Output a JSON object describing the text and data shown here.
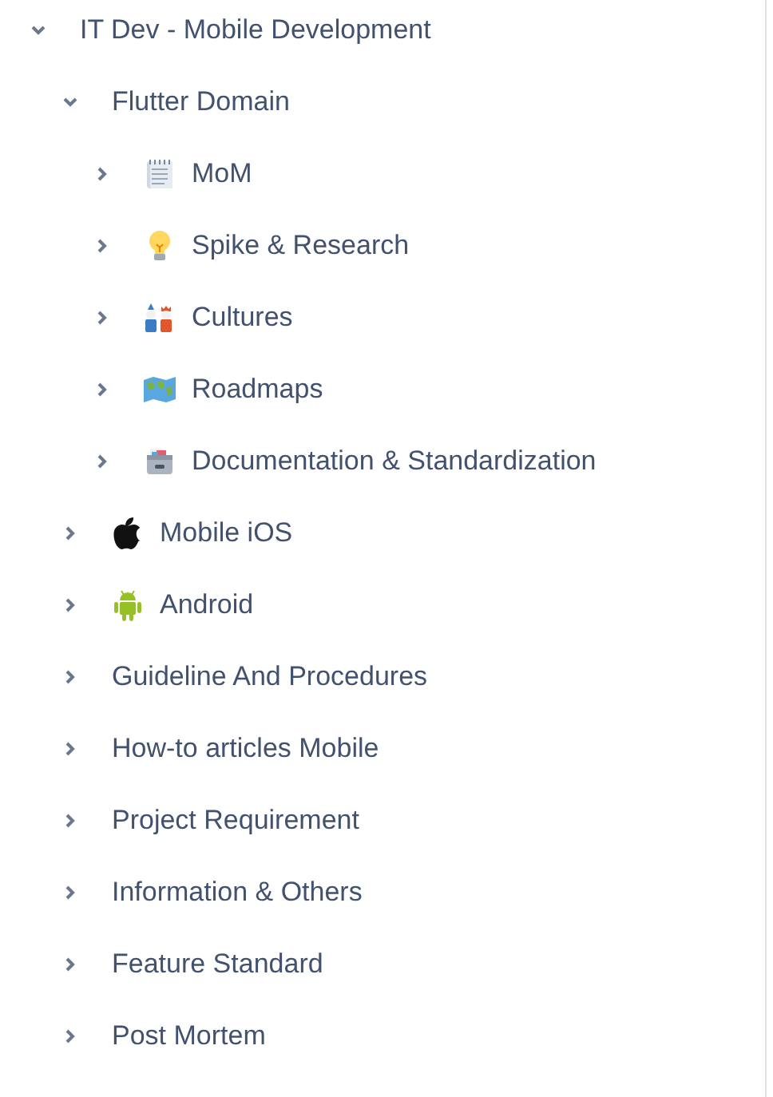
{
  "tree": [
    {
      "label": "IT Dev - Mobile Development",
      "expanded": true,
      "children": [
        {
          "label": "Flutter Domain",
          "expanded": true,
          "children": [
            {
              "label": "MoM",
              "kind": "notes",
              "expanded": false
            },
            {
              "label": "Spike & Research",
              "kind": "idea",
              "expanded": false
            },
            {
              "label": "Cultures",
              "kind": "dolls",
              "expanded": false
            },
            {
              "label": "Roadmaps",
              "kind": "map",
              "expanded": false
            },
            {
              "label": "Documentation & Standardization",
              "kind": "cabinet",
              "expanded": false
            }
          ]
        },
        {
          "label": "Mobile iOS",
          "kind": "apple",
          "expanded": false
        },
        {
          "label": "Android",
          "kind": "android",
          "expanded": false
        },
        {
          "label": "Guideline And Procedures",
          "expanded": false
        },
        {
          "label": "How-to articles Mobile",
          "expanded": false
        },
        {
          "label": "Project Requirement",
          "expanded": false
        },
        {
          "label": "Information & Others",
          "expanded": false
        },
        {
          "label": "Feature Standard",
          "expanded": false
        },
        {
          "label": "Post Mortem",
          "expanded": false
        }
      ]
    }
  ]
}
